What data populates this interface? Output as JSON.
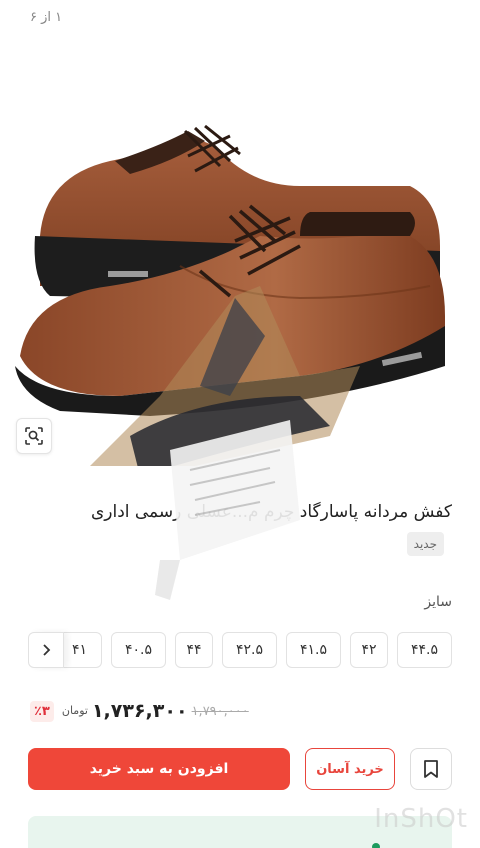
{
  "gallery": {
    "counter": "۱ از ۶"
  },
  "product": {
    "title": "کفش مردانه پاسارگاد چرم م...عسلی رسمی اداری",
    "badge": "جدید"
  },
  "sizes": {
    "label": "سایز",
    "options": [
      "۴۴.۵",
      "۴۲",
      "۴۱.۵",
      "۴۲.۵",
      "۴۴",
      "۴۰.۵",
      "۴۱"
    ]
  },
  "price": {
    "discount": "٪۳",
    "currency": "تومان",
    "current": "۱,۷۳۶,۳۰۰",
    "old": "۱,۷۹۰,۰۰۰"
  },
  "actions": {
    "easy_buy": "خرید آسان",
    "add_to_cart": "افزودن به سبد خرید"
  },
  "colors": {
    "accent": "#ef4739",
    "leather": "#9c5535",
    "sole": "#1c1c1c",
    "info_bg": "#e8f5ee"
  },
  "icons": {
    "lens": "image-search-icon",
    "chevron": "chevron-right-icon",
    "bookmark": "bookmark-icon"
  },
  "watermark": "InShOt"
}
